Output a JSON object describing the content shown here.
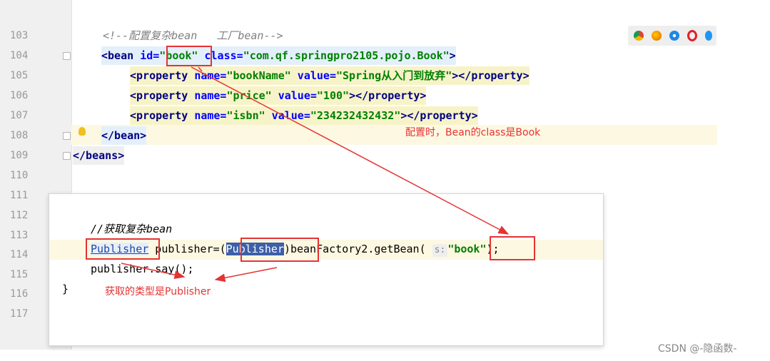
{
  "editor": {
    "line_numbers": [
      "103",
      "104",
      "105",
      "106",
      "107",
      "108",
      "109",
      "110",
      "111",
      "112",
      "113",
      "114",
      "115",
      "116",
      "117"
    ],
    "line103_comment": "<!--配置复杂bean   工厂bean-->",
    "line104": {
      "open": "<bean ",
      "id_attr": "id=",
      "id_val": "\"book\"",
      "class_attr": " class=",
      "class_val": "\"com.qf.springpro2105.pojo.Book\"",
      "close": ">"
    },
    "line105": {
      "open": "<property ",
      "name_attr": "name=",
      "name_val": "\"bookName\"",
      "value_attr": " value=",
      "value_val": "\"Spring从入门到放弃\"",
      "close": "></property>"
    },
    "line106": {
      "open": "<property ",
      "name_attr": "name=",
      "name_val": "\"price\"",
      "value_attr": " value=",
      "value_val": "\"100\"",
      "close": "></property>"
    },
    "line107": {
      "open": "<property ",
      "name_attr": "name=",
      "name_val": "\"isbn\"",
      "value_attr": " value=",
      "value_val": "\"234232432432\"",
      "close": "></property>"
    },
    "line108": "</bean>",
    "line109": "</beans>"
  },
  "popup": {
    "line112_comment": "//获取复杂bean",
    "line114": {
      "type": "Publisher",
      "var": " publisher=(",
      "cast_type": "Publisher",
      "call": ")beanFactory2.getBean( ",
      "hint": "s:",
      "arg": "\"book\"",
      "end": ");"
    },
    "line115": "publisher.say();",
    "line116": "}"
  },
  "annotations": {
    "config_note": "配置时，Bean的class是Book",
    "get_note": "获取的类型是Publisher"
  },
  "watermark": "CSDN @-隐函数-",
  "colors": {
    "accent_red": "#e53333",
    "tag": "#000080",
    "attr": "#0000ff",
    "string": "#008000"
  }
}
